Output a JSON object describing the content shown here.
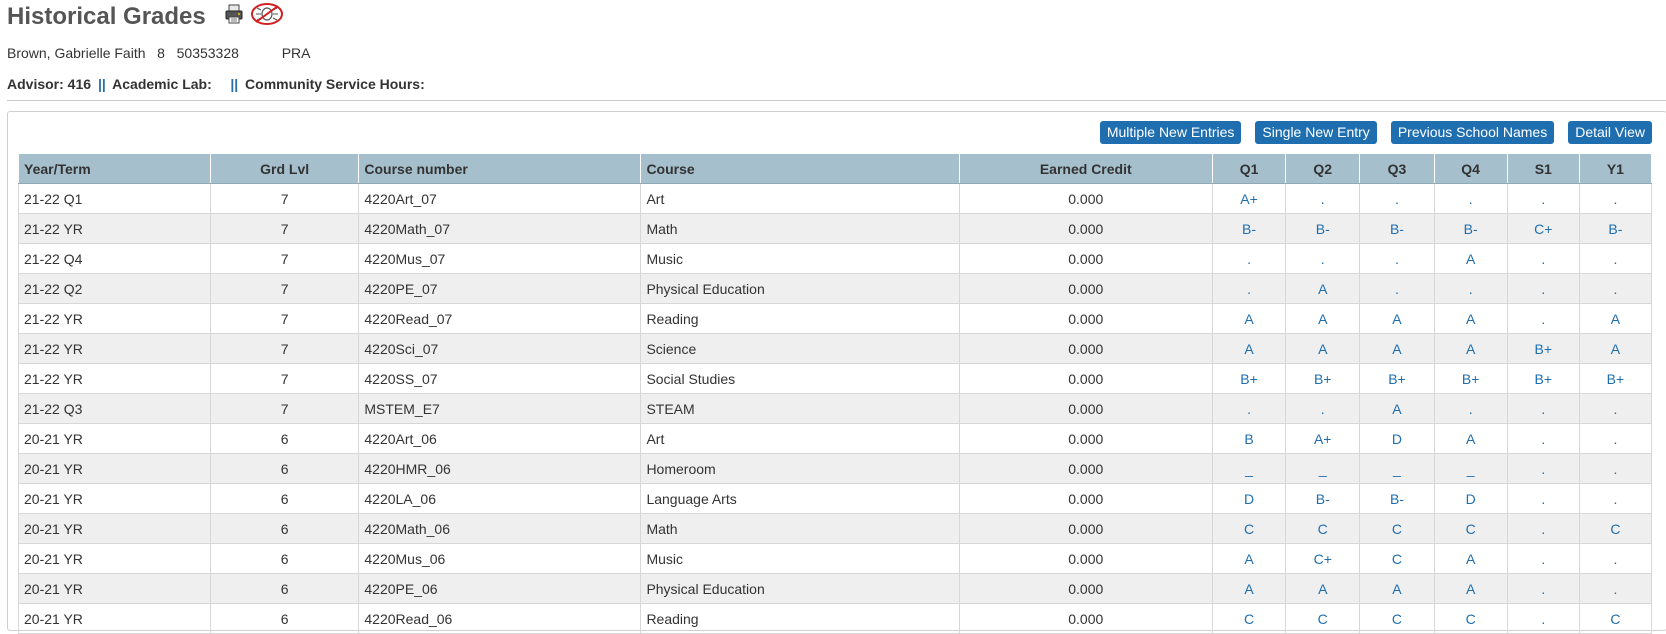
{
  "page": {
    "title": "Historical Grades"
  },
  "student": {
    "info": "Brown, Gabrielle Faith   8   50353328           PRA"
  },
  "advisor_line": {
    "advisor": "Advisor: 416",
    "sep1": "||",
    "lab": "Academic Lab:",
    "sep2": "||",
    "service": "Community Service Hours:"
  },
  "actions": {
    "multiple": "Multiple New Entries",
    "single": "Single New Entry",
    "previous": "Previous School Names",
    "detail": "Detail View"
  },
  "table": {
    "headers": [
      "Year/Term",
      "Grd Lvl",
      "Course number",
      "Course",
      "Earned Credit",
      "Q1",
      "Q2",
      "Q3",
      "Q4",
      "S1",
      "Y1"
    ],
    "rows": [
      [
        "21-22 Q1",
        "7",
        "4220Art_07",
        "Art",
        "0.000",
        "A+",
        ".",
        ".",
        ".",
        ".",
        "."
      ],
      [
        "21-22 YR",
        "7",
        "4220Math_07",
        "Math",
        "0.000",
        "B-",
        "B-",
        "B-",
        "B-",
        "C+",
        "B-"
      ],
      [
        "21-22 Q4",
        "7",
        "4220Mus_07",
        "Music",
        "0.000",
        ".",
        ".",
        ".",
        "A",
        ".",
        "."
      ],
      [
        "21-22 Q2",
        "7",
        "4220PE_07",
        "Physical Education",
        "0.000",
        ".",
        "A",
        ".",
        ".",
        ".",
        "."
      ],
      [
        "21-22 YR",
        "7",
        "4220Read_07",
        "Reading",
        "0.000",
        "A",
        "A",
        "A",
        "A",
        ".",
        "A"
      ],
      [
        "21-22 YR",
        "7",
        "4220Sci_07",
        "Science",
        "0.000",
        "A",
        "A",
        "A",
        "A",
        "B+",
        "A"
      ],
      [
        "21-22 YR",
        "7",
        "4220SS_07",
        "Social Studies",
        "0.000",
        "B+",
        "B+",
        "B+",
        "B+",
        "B+",
        "B+"
      ],
      [
        "21-22 Q3",
        "7",
        "MSTEM_E7",
        "STEAM",
        "0.000",
        ".",
        ".",
        "A",
        ".",
        ".",
        "."
      ],
      [
        "20-21 YR",
        "6",
        "4220Art_06",
        "Art",
        "0.000",
        "B",
        "A+",
        "D",
        "A",
        ".",
        "."
      ],
      [
        "20-21 YR",
        "6",
        "4220HMR_06",
        "Homeroom",
        "0.000",
        "_",
        "_",
        "_",
        "_",
        ".",
        "."
      ],
      [
        "20-21 YR",
        "6",
        "4220LA_06",
        "Language Arts",
        "0.000",
        "D",
        "B-",
        "B-",
        "D",
        ".",
        "."
      ],
      [
        "20-21 YR",
        "6",
        "4220Math_06",
        "Math",
        "0.000",
        "C",
        "C",
        "C",
        "C",
        ".",
        "C"
      ],
      [
        "20-21 YR",
        "6",
        "4220Mus_06",
        "Music",
        "0.000",
        "A",
        "C+",
        "C",
        "A",
        ".",
        "."
      ],
      [
        "20-21 YR",
        "6",
        "4220PE_06",
        "Physical Education",
        "0.000",
        "A",
        "A",
        "A",
        "A",
        ".",
        "."
      ],
      [
        "20-21 YR",
        "6",
        "4220Read_06",
        "Reading",
        "0.000",
        "C",
        "C",
        "C",
        "C",
        ".",
        "C"
      ]
    ]
  },
  "icons": {
    "printer": "printer-icon",
    "no_bug": "no-bug-icon"
  },
  "colors": {
    "link": "#1f6fb0",
    "header_bg": "#a5bfcd",
    "alt_row": "#efefef"
  }
}
